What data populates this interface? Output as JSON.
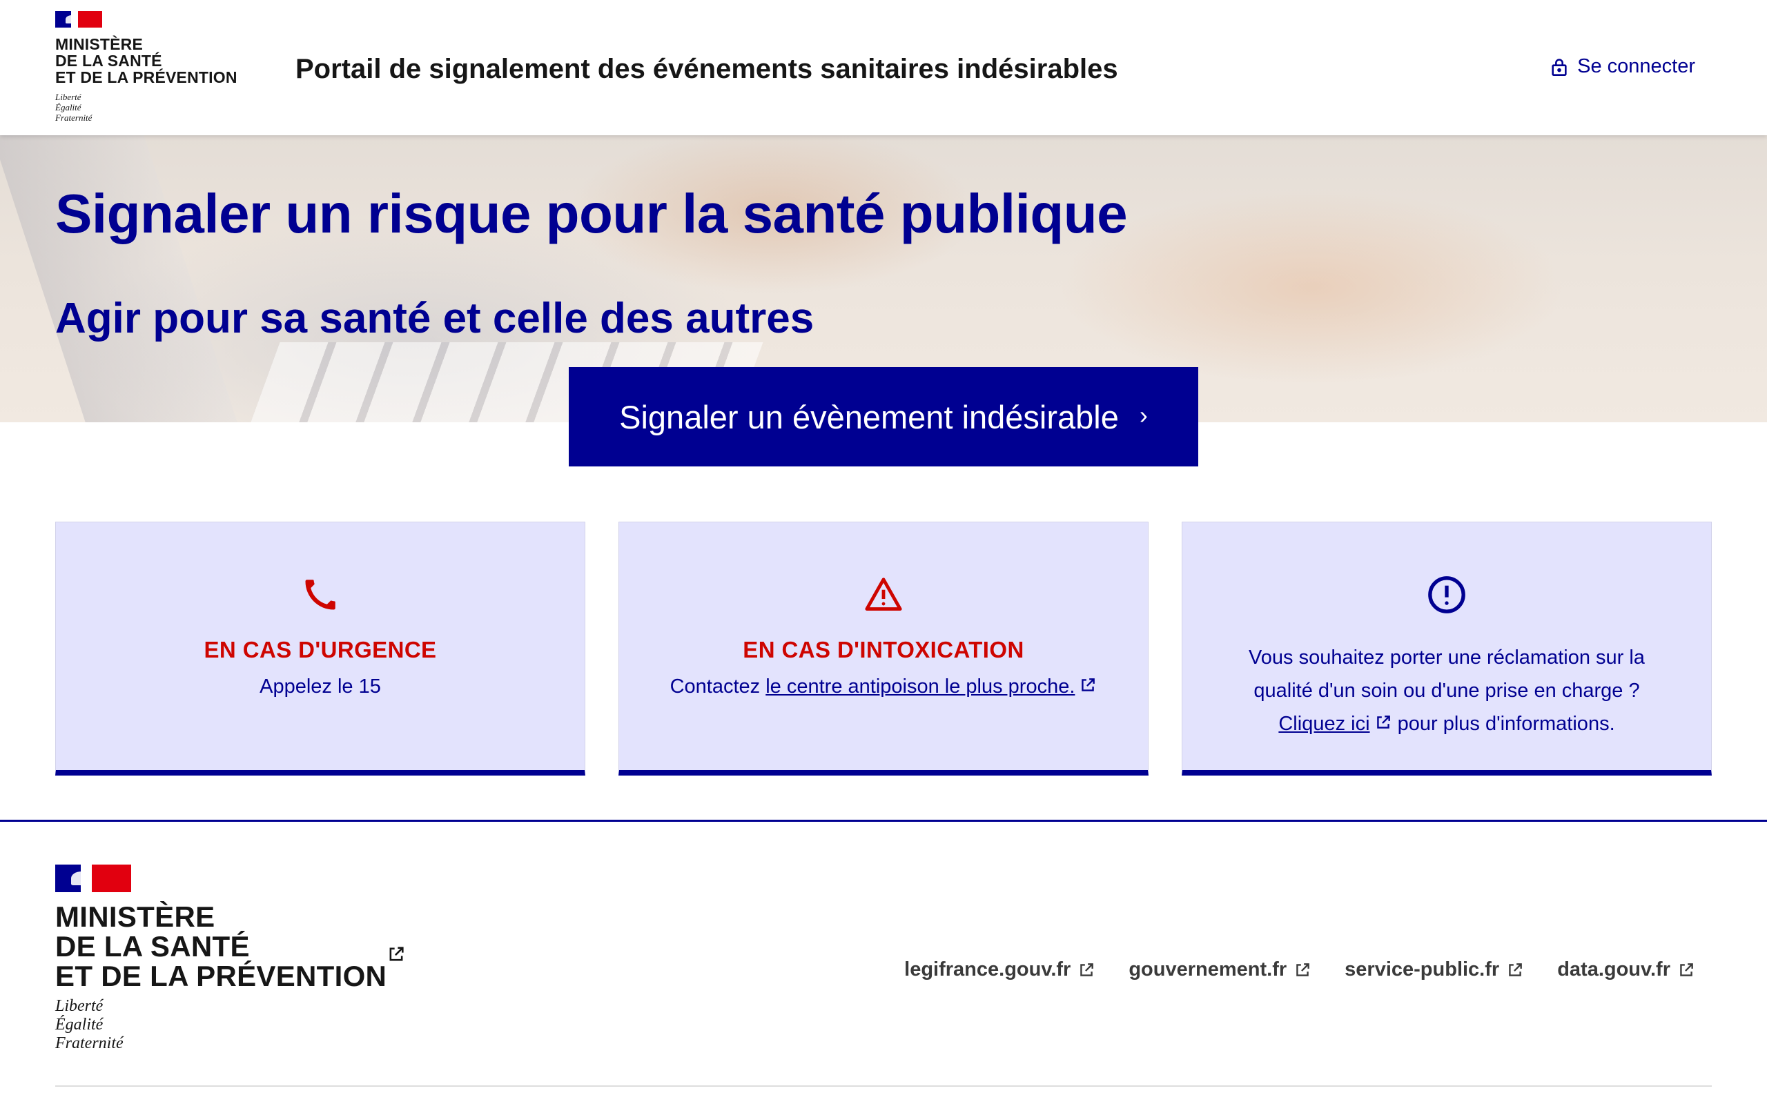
{
  "header": {
    "ministry_lines": [
      "Ministère",
      "de la santé",
      "et de la prévention"
    ],
    "motto": [
      "Liberté",
      "Égalité",
      "Fraternité"
    ],
    "service_title": "Portail de signalement des événements sanitaires indésirables",
    "login_label": "Se connecter",
    "login_icon": "lock-icon"
  },
  "hero": {
    "title": "Signaler un risque pour la santé publique",
    "subtitle": "Agir pour sa santé et celle des autres",
    "cta_label": "Signaler un évènement indésirable",
    "cta_chevron": "›"
  },
  "cards": [
    {
      "icon": "phone-icon",
      "title": "EN CAS D'URGENCE",
      "text": "Appelez le 15"
    },
    {
      "icon": "warning-icon",
      "title": "EN CAS D'INTOXICATION",
      "text_prefix": "Contactez ",
      "link_label": "le centre antipoison le plus proche."
    },
    {
      "icon": "info-circle-icon",
      "text_line1": "Vous souhaitez porter une réclamation sur la",
      "text_line2": "qualité d'un soin ou d'une prise en charge ?",
      "link_label": "Cliquez ici",
      "text_suffix": " pour plus d'informations."
    }
  ],
  "footer": {
    "ministry_lines": [
      "Ministère",
      "de la santé",
      "et de la prévention"
    ],
    "motto": [
      "Liberté",
      "Égalité",
      "Fraternité"
    ],
    "links": [
      "legifrance.gouv.fr",
      "gouvernement.fr",
      "service-public.fr",
      "data.gouv.fr"
    ]
  },
  "colors": {
    "brand_blue": "#000091",
    "brand_red": "#e1000f",
    "alert_red": "#ce0500",
    "card_bg": "#e3e3fd"
  }
}
